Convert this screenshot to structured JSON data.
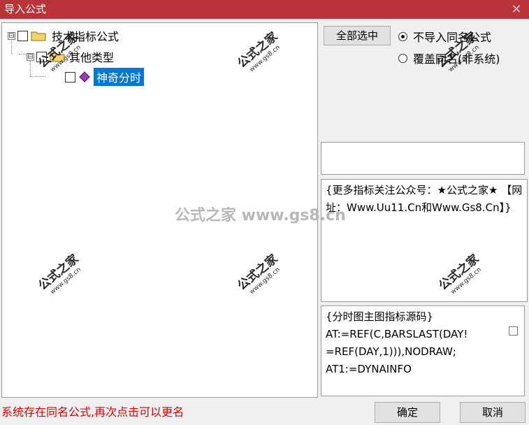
{
  "window": {
    "title": "导入公式",
    "close_symbol": "✕"
  },
  "tree": {
    "root_label": "技术指标公式",
    "child_label": "其他类型",
    "leaf_label": "神奇分时",
    "expander_symbol": "⊟"
  },
  "options": {
    "select_all_label": "全部选中",
    "radio_no_import": "不导入同名公式",
    "radio_overwrite": "覆盖同名(非系统)",
    "selected": "no_import"
  },
  "info_text": "{更多指标关注公众号：★公式之家★ 【网址：Www.Uu11.Cn和Www.Gs8.Cn】}",
  "source_lines": [
    "{分时图主图指标源码}",
    "AT:=REF(C,BARSLAST(DAY!",
    "=REF(DAY,1))),NODRAW;",
    "AT1:=DYNAINFO"
  ],
  "status_text": "系统存在同名公式,再次点击可以更名",
  "buttons": {
    "ok": "确定",
    "cancel": "取消"
  },
  "watermark": {
    "brand": "公式之家",
    "site": "www.gs8.cn",
    "center": "公式之家 www.gs8.cn"
  },
  "colors": {
    "titlebar": "#b93339",
    "selection": "#0078d7",
    "status": "#e00000"
  }
}
